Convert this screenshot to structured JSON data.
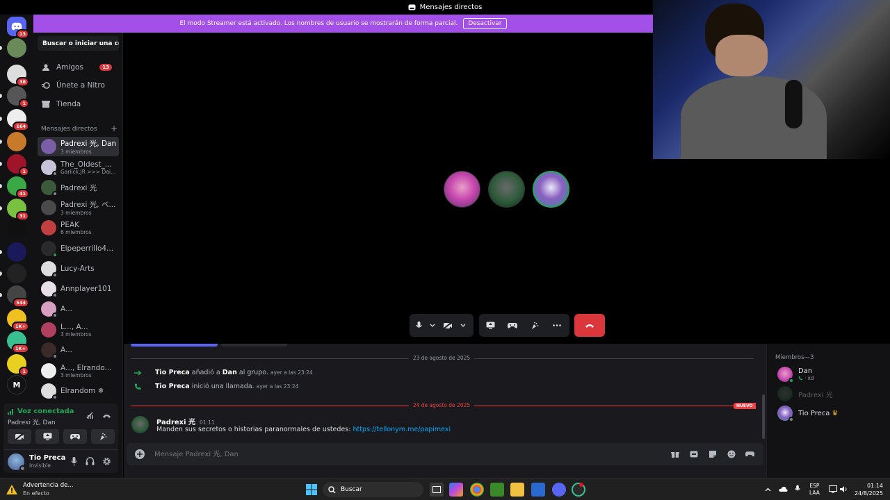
{
  "window": {
    "title": "Mensajes directos"
  },
  "banner": {
    "text": "El modo Streamer está activado. Los nombres de usuario se mostrarán de forma parcial.",
    "button": "Desactivar",
    "color": "#a350e8"
  },
  "servers": [
    {
      "badge": "13",
      "color": "#5865f2",
      "icon": "discord-logo-icon"
    },
    {
      "badge": "",
      "color": "#6b8a5a"
    },
    {
      "badge": "38",
      "color": "#ddd"
    },
    {
      "badge": "1",
      "color": "#555"
    },
    {
      "badge": "164",
      "color": "#eee"
    },
    {
      "badge": "",
      "color": "#c77b2a"
    },
    {
      "badge": "1",
      "color": "#a0142a"
    },
    {
      "badge": "41",
      "color": "#3aa845"
    },
    {
      "badge": "31",
      "color": "#7ac142"
    },
    {
      "badge": "",
      "color": "#101010"
    },
    {
      "badge": "",
      "color": "#1a1a5a"
    },
    {
      "badge": "",
      "color": "#222"
    },
    {
      "badge": "544",
      "color": "#444"
    },
    {
      "badge": "1K+",
      "color": "#f0c020"
    },
    {
      "badge": "1K+",
      "color": "#3ac090"
    },
    {
      "badge": "1",
      "color": "#e8d020"
    },
    {
      "badge": "",
      "color": "#121214",
      "letter": "M"
    }
  ],
  "sidebar": {
    "search": "Buscar o iniciar una co...",
    "nav": [
      {
        "label": "Amigos",
        "badge": "13",
        "icon": "friends-icon"
      },
      {
        "label": "Únete a Nitro",
        "badge": "",
        "icon": "nitro-icon"
      },
      {
        "label": "Tienda",
        "badge": "",
        "icon": "shop-icon"
      }
    ],
    "dm_header": "Mensajes directos",
    "dm_add": "+",
    "dms": [
      {
        "name": "Padrexi 光, Dan",
        "sub": "3 miembros",
        "color": "#7b5ea8",
        "status": "",
        "active": true
      },
      {
        "name": "The_Oldest_...",
        "sub": "Garlick.JR >>> Dai...",
        "color": "#c9c3d8",
        "status": "off"
      },
      {
        "name": "Padrexi 光",
        "sub": "",
        "color": "#3a5a3a",
        "status": "off"
      },
      {
        "name": "Padrexi 光, ベ...",
        "sub": "3 miembros",
        "color": "#4a4a4a",
        "status": ""
      },
      {
        "name": "PEAK",
        "sub": "6 miembros",
        "color": "#c04040",
        "status": ""
      },
      {
        "name": "Elpeperrillo4...",
        "sub": "",
        "color": "#2a2a2a",
        "status": "on"
      },
      {
        "name": "Lucy-Arts",
        "sub": "",
        "color": "#ddd",
        "status": "off"
      },
      {
        "name": "Annplayer101",
        "sub": "",
        "color": "#e8e0e8",
        "status": "off"
      },
      {
        "name": "A...",
        "sub": "",
        "color": "#d8a0c0",
        "status": "off"
      },
      {
        "name": "L..., A...",
        "sub": "3 miembros",
        "color": "#b04060",
        "status": ""
      },
      {
        "name": "A...",
        "sub": "",
        "color": "#3a2a2a",
        "status": "off"
      },
      {
        "name": "A..., Elrando...",
        "sub": "3 miembros",
        "color": "#eee",
        "status": ""
      },
      {
        "name": "Elrandom ❄",
        "sub": "",
        "color": "#ddd",
        "status": "off"
      }
    ]
  },
  "voice": {
    "status": "Voz conectada",
    "channel": "Padrexi 光, Dan",
    "color": "#23a55a"
  },
  "user": {
    "name": "Tio Preca",
    "status": "Invisible"
  },
  "call": {
    "participants": [
      {
        "color": "#c94ab0"
      },
      {
        "color": "#2e5a3a"
      },
      {
        "color": "#6aa0c0"
      }
    ]
  },
  "chat": {
    "day1": "23 de agosto de 2025",
    "sys1": {
      "who": "Tio Preca",
      "action": "añadió a",
      "target": "Dan",
      "rest": "al grupo.",
      "time": "ayer a las 23:24"
    },
    "sys2": {
      "who": "Tio Preca",
      "action": "inició una llamada.",
      "time": "ayer a las 23:24"
    },
    "day2": "24 de agosto de 2025",
    "new_badge": "NUEVO",
    "msg": {
      "author": "Padrexi 光",
      "time": "01:11",
      "text": "Manden sus secretos o historias paranormales de ustedes:",
      "link": "https://tellonym.me/papimexi"
    },
    "composer_placeholder": "Mensaje Padrexi 光, Dan"
  },
  "members": {
    "header": "Miembros—3",
    "list": [
      {
        "name": "Dan",
        "sub": "xd",
        "color": "#c94ab0",
        "status": "on"
      },
      {
        "name": "Padrexi 光",
        "sub": "",
        "color": "#2e5a3a",
        "status": "off"
      },
      {
        "name": "Tio Preca",
        "sub": "",
        "color": "#6aa0c0",
        "status": "off",
        "crown": "♛"
      }
    ]
  },
  "taskbar": {
    "notif_title": "Advertencia de...",
    "notif_sub": "En efecto",
    "search": "Buscar",
    "lang1": "ESP",
    "lang2": "LAA",
    "time": "01:14",
    "date": "24/8/2025"
  }
}
